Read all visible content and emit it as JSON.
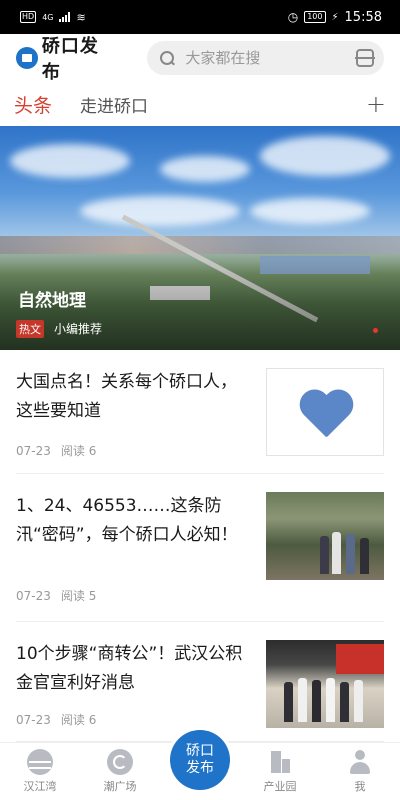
{
  "status_bar": {
    "left": [
      "HD",
      "4G"
    ],
    "battery": "100",
    "time": "15:58"
  },
  "header": {
    "logo_text": "硚口发布",
    "search_placeholder": "大家都在搜"
  },
  "tabs": [
    {
      "label": "头条",
      "active": true
    },
    {
      "label": "走进硚口",
      "active": false
    }
  ],
  "banner": {
    "title": "自然地理",
    "tag": "热文",
    "source": "小编推荐"
  },
  "news": [
    {
      "title": "大国点名！关系每个硚口人，这些要知道",
      "date": "07-23",
      "reads": "阅读 6"
    },
    {
      "title": "1、24、46553……这条防汛“密码”，每个硚口人必知！",
      "date": "07-23",
      "reads": "阅读 5"
    },
    {
      "title": "10个步骤“商转公”！武汉公积金官宣利好消息",
      "date": "07-23",
      "reads": "阅读 6"
    }
  ],
  "bottom_nav": [
    {
      "label": "汉江湾",
      "icon": "bay-icon"
    },
    {
      "label": "潮广场",
      "icon": "square-icon"
    },
    {
      "label": "硚口发布",
      "icon": "center-icon"
    },
    {
      "label": "产业园",
      "icon": "park-icon"
    },
    {
      "label": "我",
      "icon": "me-icon"
    }
  ],
  "colors": {
    "accent": "#d93f2f",
    "brand": "#1f73c8",
    "tag": "#c5372b"
  }
}
